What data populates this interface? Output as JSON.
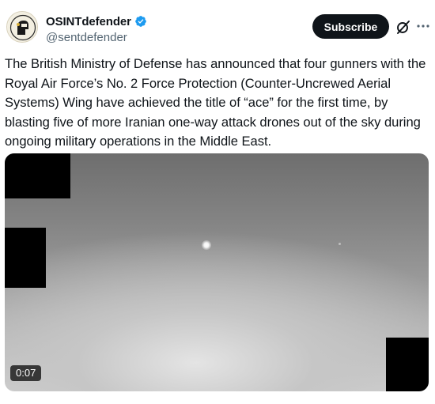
{
  "author": {
    "display_name": "OSINTdefender",
    "handle": "@sentdefender",
    "verified": true,
    "avatar_icon": "avatar-logo-icon"
  },
  "actions": {
    "subscribe_label": "Subscribe",
    "grok_icon": "grok-icon",
    "more_icon": "more-icon"
  },
  "tweet": {
    "text": "The British Ministry of Defense has announced that four gunners with the Royal Air Force’s No. 2 Force Protection (Counter-Uncrewed Aerial Systems) Wing have achieved the title of “ace” for the first time, by blasting five of more Iranian one-way attack drones out of the sky during ongoing military operations in the Middle East."
  },
  "media": {
    "duration": "0:07"
  },
  "colors": {
    "verified_blue": "#1d9bf0",
    "text_primary": "#0f1419",
    "text_secondary": "#536471",
    "button_bg": "#0f1419"
  }
}
